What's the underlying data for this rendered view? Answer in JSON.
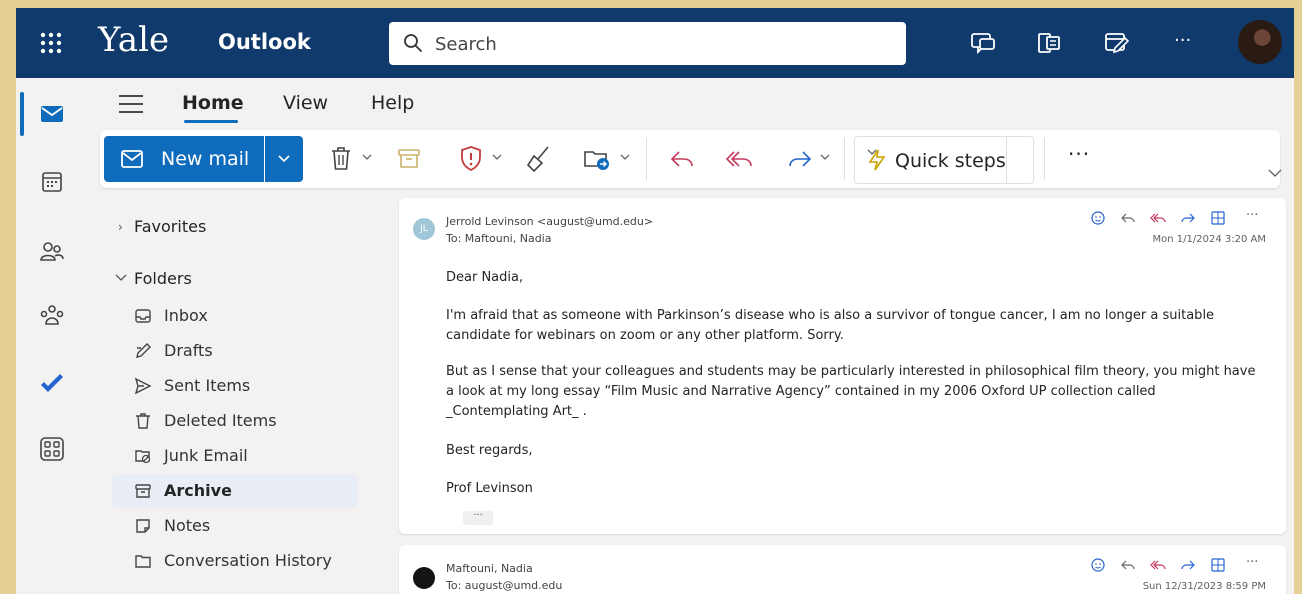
{
  "topbar": {
    "brand": "Yale",
    "app_name": "Outlook",
    "search_placeholder": "Search",
    "more": "···"
  },
  "menu": {
    "tabs": [
      "Home",
      "View",
      "Help"
    ],
    "active_tab": "Home"
  },
  "ribbon": {
    "new_mail": "New mail",
    "quick_steps": "Quick steps",
    "more": "···"
  },
  "folders": {
    "favorites": "Favorites",
    "folders": "Folders",
    "items": [
      "Inbox",
      "Drafts",
      "Sent Items",
      "Deleted Items",
      "Junk Email",
      "Archive",
      "Notes",
      "Conversation History"
    ],
    "active": "Archive"
  },
  "messages": [
    {
      "initials": "JL",
      "from": "Jerrold Levinson <august@umd.edu>",
      "to": "To: Maftouni, Nadia",
      "date": "Mon 1/1/2024 3:20 AM",
      "body": [
        "Dear Nadia,",
        "I'm afraid that as someone with Parkinson’s disease who is also a survivor of tongue cancer, I am no longer a suitable candidate for webinars on zoom or any other platform. Sorry.",
        "But as I sense that your colleagues and students may be particularly interested in philosophical film theory, you might have a look at my long essay “Film Music and Narrative Agency” contained in my 2006 Oxford UP collection called _Contemplating Art_ .",
        "Best regards,",
        "Prof Levinson"
      ],
      "collapsed": "···"
    },
    {
      "from": "Maftouni, Nadia",
      "to": "To: august@umd.edu",
      "date": "Sun 12/31/2023 8:59 PM"
    }
  ],
  "message_actions_more": "···",
  "colors": {
    "header": "#0f3a6b",
    "accent": "#0f6cbd",
    "reply": "#c43b5c",
    "background": "#e6cf95"
  }
}
